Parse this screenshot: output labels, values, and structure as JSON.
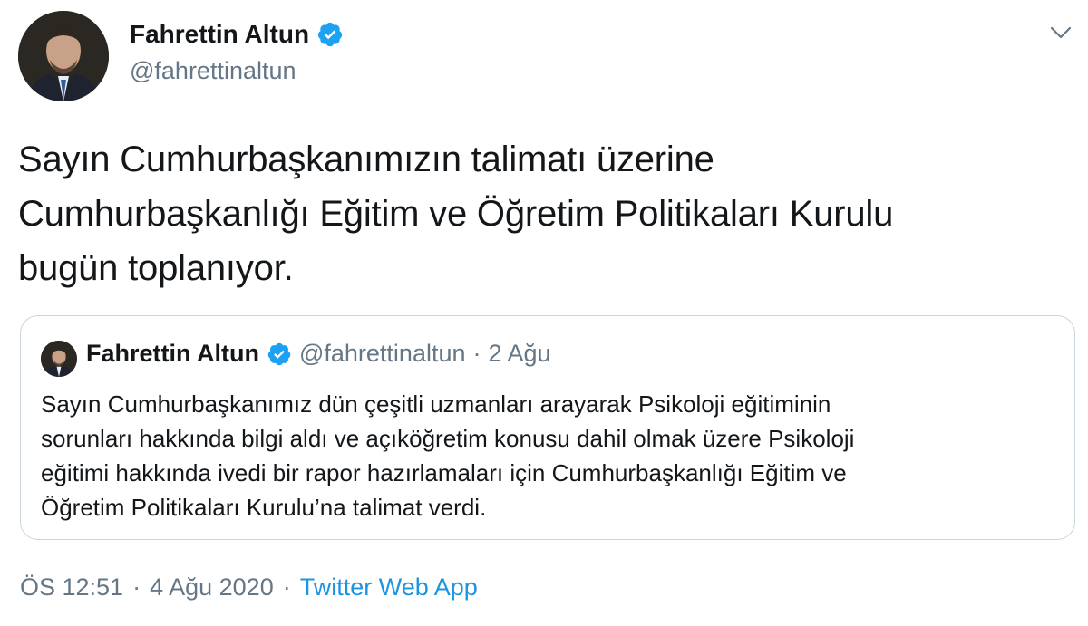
{
  "tweet": {
    "author": {
      "name": "Fahrettin Altun",
      "handle": "@fahrettinaltun",
      "verified": true
    },
    "text_lines": [
      "Sayın Cumhurbaşkanımızın talimatı üzerine",
      "Cumhurbaşkanlığı Eğitim ve Öğretim Politikaları Kurulu",
      "bugün toplanıyor."
    ],
    "quoted": {
      "name": "Fahrettin Altun",
      "handle": "@fahrettinaltun",
      "separator": "·",
      "date": "2 Ağu",
      "text_lines": [
        "Sayın Cumhurbaşkanımız dün çeşitli uzmanları arayarak Psikoloji eğitiminin",
        "sorunları hakkında bilgi aldı ve açıköğretim konusu dahil olmak üzere Psikoloji",
        "eğitimi hakkında ivedi bir rapor hazırlamaları için Cumhurbaşkanlığı Eğitim ve",
        "Öğretim Politikaları Kurulu’na talimat verdi."
      ]
    },
    "footer": {
      "time": "ÖS 12:51",
      "separator1": "·",
      "date": "4 Ağu 2020",
      "separator2": "·",
      "source": "Twitter Web App"
    }
  },
  "icons": {
    "verified": "verified-badge-icon",
    "menu": "chevron-down-icon"
  },
  "colors": {
    "text": "#14171a",
    "secondary": "#657786",
    "link": "#1b95e0",
    "verified": "#1da1f2",
    "border": "#ccd6dd"
  }
}
